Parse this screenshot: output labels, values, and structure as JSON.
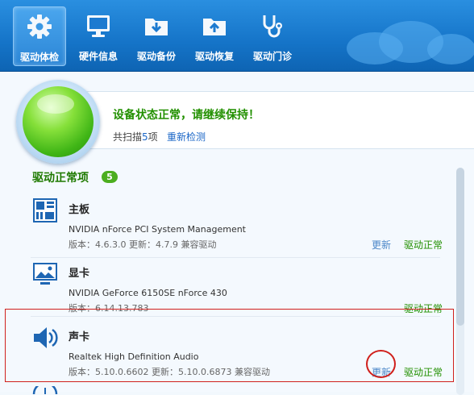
{
  "toolbar": {
    "items": [
      {
        "label": "驱动体检",
        "icon": "gear-icon",
        "active": true
      },
      {
        "label": "硬件信息",
        "icon": "monitor-icon",
        "active": false
      },
      {
        "label": "驱动备份",
        "icon": "folder-download-icon",
        "active": false
      },
      {
        "label": "驱动恢复",
        "icon": "folder-upload-icon",
        "active": false
      },
      {
        "label": "驱动门诊",
        "icon": "stethoscope-icon",
        "active": false
      }
    ]
  },
  "status": {
    "title": "设备状态正常，请继续保持！",
    "scan_prefix": "共扫描",
    "scan_count": "5",
    "scan_suffix": "项",
    "rescan_label": "重新检测",
    "indicator_color": "#3fb516"
  },
  "section": {
    "title": "驱动正常项",
    "count": "5"
  },
  "drivers": [
    {
      "category": "主板",
      "icon": "motherboard-icon",
      "model": "NVIDIA nForce PCI System Management",
      "version": "版本：4.6.3.0 更新：4.7.9 兼容驱动",
      "update_label": "更新",
      "status": "驱动正常"
    },
    {
      "category": "显卡",
      "icon": "display-icon",
      "model": "NVIDIA GeForce 6150SE nForce 430",
      "version": "版本：6.14.13.783",
      "update_label": "",
      "status": "驱动正常"
    },
    {
      "category": "声卡",
      "icon": "speaker-icon",
      "model": "Realtek High Definition Audio",
      "version": "版本：5.10.0.6602 更新：5.10.0.6873 兼容驱动",
      "update_label": "更新",
      "status": "驱动正常"
    }
  ],
  "colors": {
    "toolbar": "#1574c8",
    "ok_green": "#229000",
    "link_blue": "#1a66c7",
    "highlight_red": "#d0201c"
  }
}
